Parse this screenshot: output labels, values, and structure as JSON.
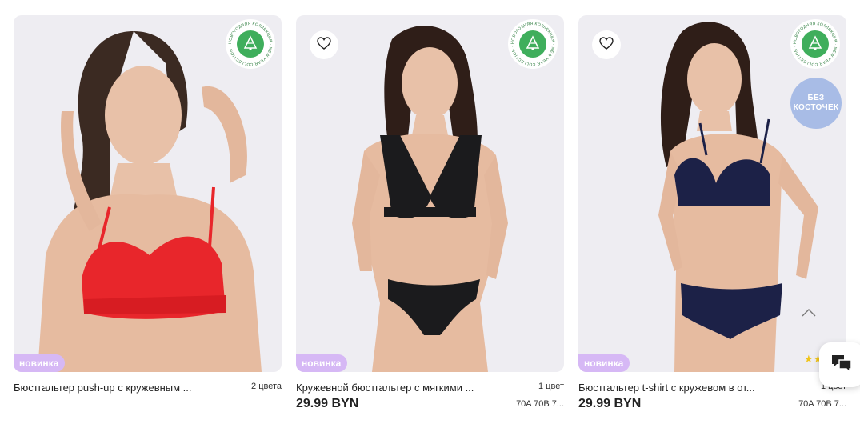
{
  "products": [
    {
      "name": "Бюстгальтер push-up с кружевным ...",
      "colors": "2 цвета",
      "price": "",
      "sizes": "",
      "tag": "новинка",
      "badge_text": "НОВОГОДНЯЯ КОЛЛЕКЦИЯ · NEW YEAR COLLECTION ·",
      "lingerie_color": "#e8262b"
    },
    {
      "name": "Кружевной бюстгальтер с мягкими ...",
      "colors": "1 цвет",
      "price": "29.99 BYN",
      "sizes": "70A 70B 7...",
      "tag": "новинка",
      "badge_text": "НОВОГОДНЯЯ КОЛЛЕКЦИЯ · NEW YEAR COLLECTION ·",
      "lingerie_color": "#1b1b1d"
    },
    {
      "name": "Бюстгальтер t-shirt с кружевом в от...",
      "colors": "1 цвет",
      "price": "29.99 BYN",
      "sizes": "70A 70B 7...",
      "tag": "новинка",
      "badge_text": "НОВОГОДНЯЯ КОЛЛЕКЦИЯ · NEW YEAR COLLECTION ·",
      "feature_badge": "БЕЗ\nКОСТОЧЕК",
      "stars": "★★★",
      "lingerie_color": "#1c2147"
    }
  ],
  "colors": {
    "tag_bg": "#d6b8f5",
    "badge_green": "#3fae5c",
    "feature_badge_bg": "#a8bce6",
    "card_bg": "#eeedf2"
  },
  "icons": {
    "favorite": "heart-outline-icon",
    "collection": "christmas-tree-icon",
    "scroll_up": "chevron-up-icon",
    "chat": "chat-bubbles-icon"
  }
}
